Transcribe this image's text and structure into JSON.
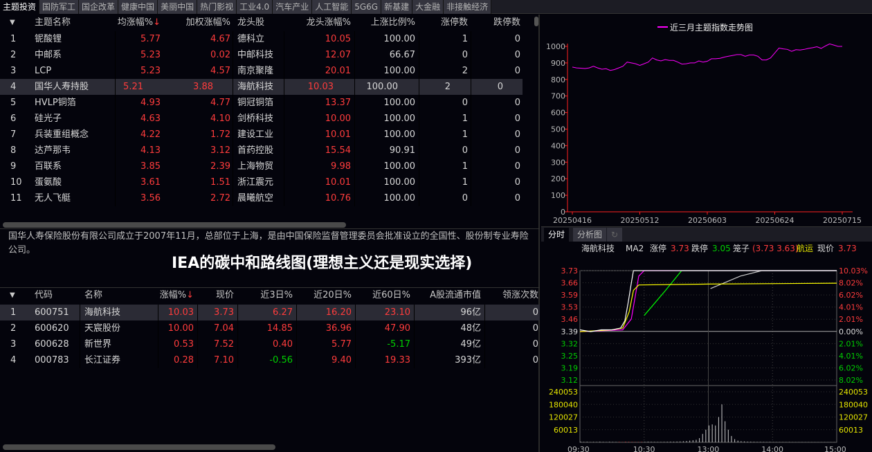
{
  "tabs": [
    "主题投资",
    "国防军工",
    "国企改革",
    "健康中国",
    "美丽中国",
    "热门影视",
    "工业4.0",
    "汽车产业",
    "人工智能",
    "5G6G",
    "新基建",
    "大金融",
    "非接触经济"
  ],
  "theme_table": {
    "headers": [
      "主题名称",
      "均涨幅%",
      "加权涨幅%",
      "龙头股",
      "龙头涨幅%",
      "上涨比例%",
      "涨停数",
      "跌停数"
    ],
    "sort_icon": "↓",
    "rows": [
      [
        "1",
        "铌酸锂",
        "5.77",
        "4.67",
        "德科立",
        "10.05",
        "100.00",
        "1",
        "0"
      ],
      [
        "2",
        "中邮系",
        "5.23",
        "0.02",
        "中邮科技",
        "12.07",
        "66.67",
        "0",
        "0"
      ],
      [
        "3",
        "LCP",
        "5.23",
        "4.57",
        "南京聚隆",
        "20.01",
        "100.00",
        "2",
        "0"
      ],
      [
        "4",
        "国华人寿持股",
        "5.21",
        "3.88",
        "海航科技",
        "10.03",
        "100.00",
        "2",
        "0"
      ],
      [
        "5",
        "HVLP铜箔",
        "4.93",
        "4.77",
        "铜冠铜箔",
        "13.37",
        "100.00",
        "0",
        "0"
      ],
      [
        "6",
        "硅光子",
        "4.63",
        "4.10",
        "剑桥科技",
        "10.00",
        "100.00",
        "1",
        "0"
      ],
      [
        "7",
        "兵装重组概念",
        "4.22",
        "1.72",
        "建设工业",
        "10.01",
        "100.00",
        "1",
        "0"
      ],
      [
        "8",
        "达芦那韦",
        "4.13",
        "3.12",
        "首药控股",
        "15.54",
        "90.91",
        "0",
        "0"
      ],
      [
        "9",
        "百联系",
        "3.85",
        "2.39",
        "上海物贸",
        "9.98",
        "100.00",
        "1",
        "0"
      ],
      [
        "10",
        "蛋氨酸",
        "3.61",
        "1.51",
        "浙江震元",
        "10.01",
        "100.00",
        "1",
        "0"
      ],
      [
        "11",
        "无人飞艇",
        "3.56",
        "2.72",
        "晨曦航空",
        "10.76",
        "100.00",
        "0",
        "0"
      ]
    ]
  },
  "description": "国华人寿保险股份有限公司成立于2007年11月，总部位于上海，是由中国保险监督管理委员会批准设立的全国性、股份制专业寿险公司。",
  "overlay_title": "IEA的碳中和路线图(理想主义还是现实选择)",
  "stock_table": {
    "headers": [
      "代码",
      "名称",
      "涨幅%",
      "现价",
      "近3日%",
      "近20日%",
      "近60日%",
      "A股流通市值",
      "领涨次数"
    ],
    "rows": [
      [
        "1",
        "600751",
        "海航科技",
        "10.03",
        "3.73",
        "6.27",
        "16.20",
        "23.10",
        "96亿",
        "0"
      ],
      [
        "2",
        "600620",
        "天宸股份",
        "10.00",
        "7.04",
        "14.85",
        "36.96",
        "47.90",
        "48亿",
        "0"
      ],
      [
        "3",
        "600628",
        "新世界",
        "0.53",
        "7.52",
        "0.40",
        "5.77",
        "-5.17",
        "49亿",
        "0"
      ],
      [
        "4",
        "000783",
        "长江证券",
        "0.28",
        "7.10",
        "-0.56",
        "9.40",
        "19.33",
        "393亿",
        "0"
      ]
    ]
  },
  "right_tabs": [
    "分时",
    "分析图"
  ],
  "chart_data": [
    {
      "type": "line",
      "title": "近三月主题指数走势图",
      "legend": "近三月主题指数走势图",
      "color": "#ff00ff",
      "ylim": [
        0,
        1000
      ],
      "yticks": [
        "0",
        "100",
        "200",
        "300",
        "400",
        "500",
        "600",
        "700",
        "800",
        "900",
        "1000"
      ],
      "xticks": [
        "20250416",
        "20250512",
        "20250603",
        "20250624",
        "20250715"
      ],
      "values": [
        875,
        870,
        868,
        866,
        870,
        880,
        870,
        862,
        865,
        855,
        860,
        870,
        880,
        905,
        900,
        895,
        885,
        895,
        905,
        930,
        918,
        912,
        920,
        915,
        915,
        905,
        893,
        895,
        900,
        900,
        912,
        905,
        910,
        925,
        925,
        928,
        935,
        940,
        945,
        950,
        950,
        940,
        948,
        948,
        940,
        918,
        918,
        930,
        960,
        990,
        985,
        982,
        970,
        980,
        978,
        982,
        988,
        992,
        998,
        988,
        1002,
        1015,
        1008,
        1000,
        1000
      ]
    },
    {
      "type": "line",
      "title": "分时",
      "stock": "海航科技",
      "ma_label": "MA2",
      "limit_up_label": "涨停",
      "limit_up": "3.73",
      "limit_down_label": "跌停",
      "limit_down": "3.05",
      "cage_label": "笼子",
      "cage": "(3.73 3.63)",
      "sector": "航运",
      "price_label": "现价",
      "price": "3.73",
      "prev_close": 3.39,
      "ylim": [
        3.12,
        3.73
      ],
      "price_ticks": [
        "3.73",
        "3.66",
        "3.59",
        "3.53",
        "3.46",
        "3.39",
        "3.32",
        "3.25",
        "3.19",
        "3.12"
      ],
      "pct_ticks": [
        "10.03%",
        "8.02%",
        "6.02%",
        "4.01%",
        "2.01%",
        "0.00%",
        "2.01%",
        "4.01%",
        "6.02%",
        "8.02%"
      ],
      "volume_ticks": [
        "240053",
        "180040",
        "120027",
        "60013"
      ],
      "time_ticks": [
        "09:30",
        "10:30",
        "13:00",
        "14:00",
        "15:00"
      ],
      "price_series": [
        [
          0,
          3.4
        ],
        [
          10,
          3.39
        ],
        [
          20,
          3.4
        ],
        [
          30,
          3.4
        ],
        [
          38,
          3.41
        ],
        [
          42,
          3.45
        ],
        [
          45,
          3.55
        ],
        [
          48,
          3.66
        ],
        [
          50,
          3.73
        ],
        [
          240,
          3.73
        ]
      ],
      "avg_series": [
        [
          0,
          3.39
        ],
        [
          30,
          3.4
        ],
        [
          40,
          3.41
        ],
        [
          46,
          3.5
        ],
        [
          50,
          3.62
        ],
        [
          55,
          3.65
        ],
        [
          120,
          3.655
        ],
        [
          240,
          3.66
        ]
      ],
      "ma_series": [
        [
          0,
          3.39
        ],
        [
          40,
          3.4
        ],
        [
          48,
          3.46
        ],
        [
          55,
          3.7
        ],
        [
          60,
          3.73
        ],
        [
          240,
          3.73
        ]
      ],
      "ma2_series": [
        [
          60,
          3.48
        ],
        [
          80,
          3.62
        ],
        [
          95,
          3.73
        ],
        [
          240,
          3.73
        ]
      ],
      "ma3_series": [
        [
          122,
          3.63
        ],
        [
          150,
          3.7
        ],
        [
          170,
          3.73
        ],
        [
          240,
          3.73
        ]
      ],
      "volume": [
        3000,
        2000,
        2500,
        1500,
        2000,
        1800,
        3000,
        2000,
        1500,
        2500,
        2000,
        1800,
        2200,
        1500,
        3000,
        2500,
        2000,
        1800,
        1600,
        2000,
        2200,
        3000,
        2500,
        2000,
        1800,
        2000,
        2200,
        2500,
        3000,
        2800,
        3500,
        4000,
        5000,
        6000,
        8000,
        10000,
        12000,
        20000,
        40000,
        60000,
        80000,
        85000,
        80000,
        120000,
        180000,
        100000,
        60000,
        30000,
        15000,
        8000,
        5000,
        4000,
        3000,
        3000,
        2500,
        2000,
        2000,
        1800,
        1500,
        2000,
        1500,
        1200,
        1000,
        1200,
        1000,
        1500,
        1000,
        800,
        1000,
        1200,
        800,
        900,
        1000,
        800,
        700,
        900,
        800,
        600,
        700,
        800
      ]
    }
  ]
}
